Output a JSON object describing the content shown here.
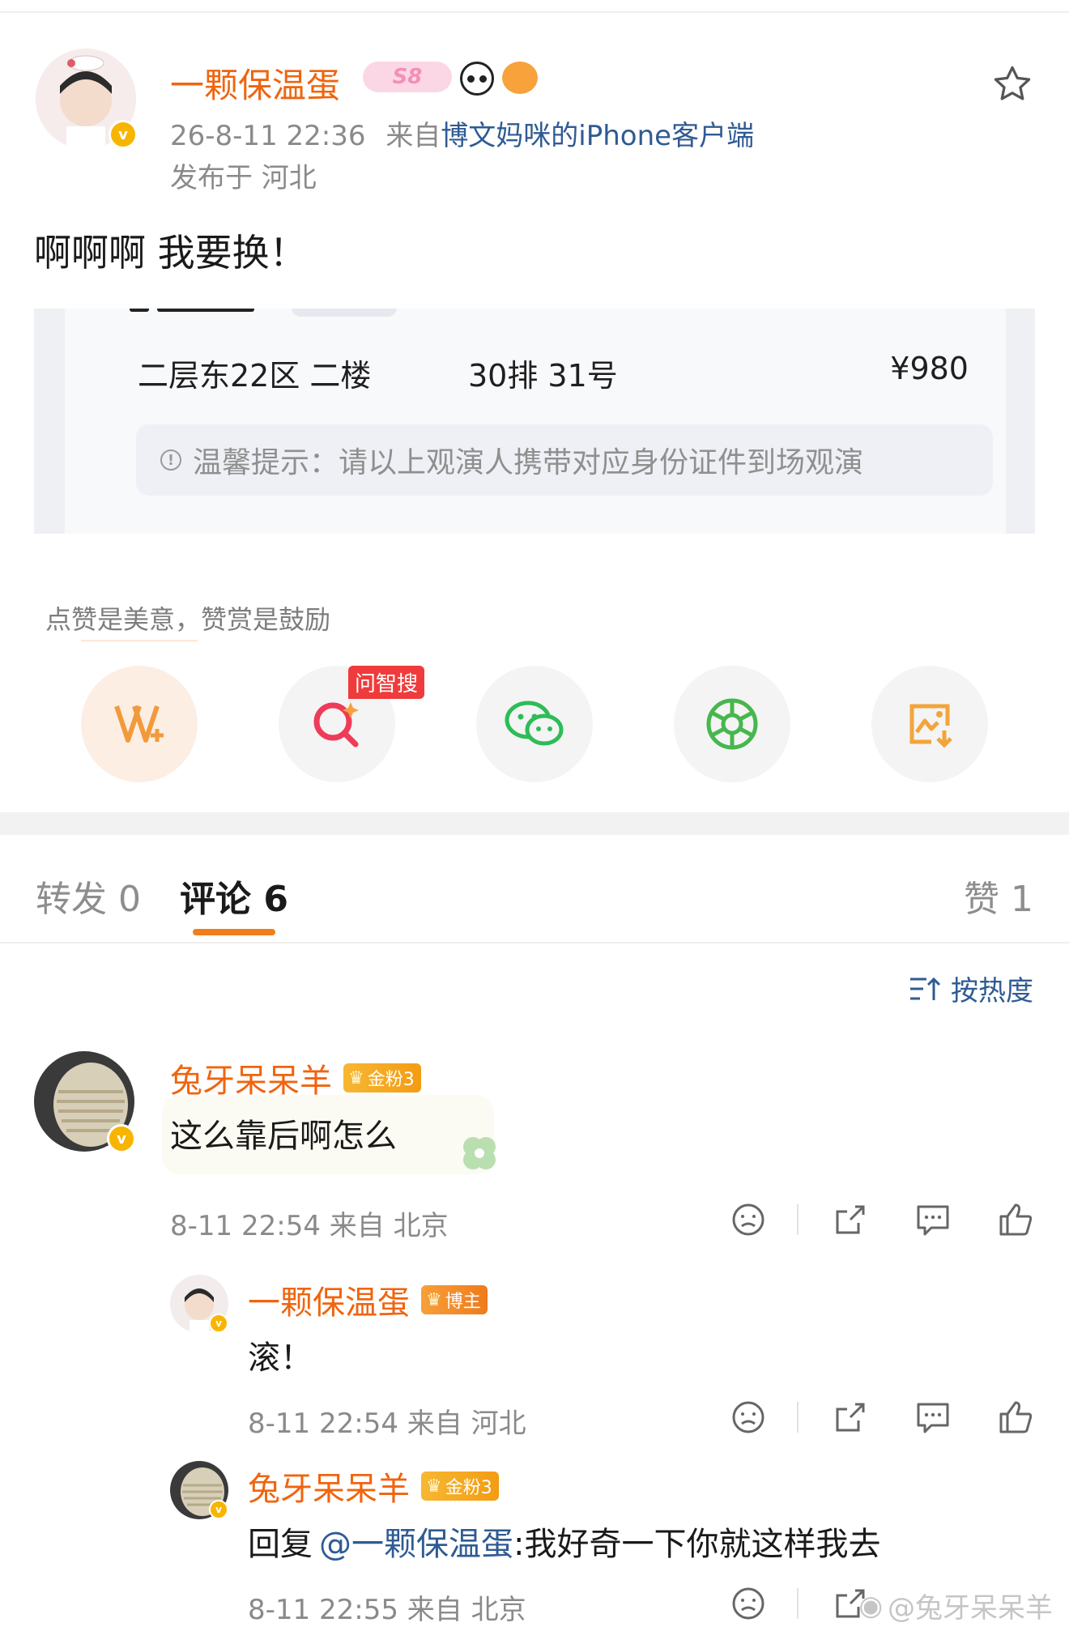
{
  "post": {
    "author": "一颗保温蛋",
    "level_badge": "S8",
    "timestamp": "26-8-11 22:36",
    "source_prefix": "来自",
    "source_device": "博文妈咪的iPhone客户端",
    "location": "发布于 河北",
    "text": "啊啊啊 我要换！"
  },
  "ticket": {
    "seat_area": "二层东22区 二楼",
    "seat_number": "30排 31号",
    "price": "¥980",
    "notice": "温馨提示：请以上观演人携带对应身份证件到场观演"
  },
  "reward_hint": "点赞是美意，赞赏是鼓励",
  "share": {
    "ai_tag": "问智搜",
    "buttons": [
      "vplus-icon",
      "ai-search-icon",
      "wechat-icon",
      "moments-icon",
      "save-image-icon"
    ]
  },
  "tabs": {
    "repost_label": "转发",
    "repost_count": "0",
    "comment_label": "评论",
    "comment_count": "6",
    "like_label": "赞",
    "like_count": "1"
  },
  "sort_label": "按热度",
  "comments": [
    {
      "user": "兔牙呆呆羊",
      "badge": "金粉3",
      "text": "这么靠后啊怎么",
      "time": "8-11 22:54",
      "from": "来自 北京"
    }
  ],
  "replies": [
    {
      "user": "一颗保温蛋",
      "badge": "博主",
      "text": "滚！",
      "time": "8-11 22:54",
      "from": "来自 河北"
    },
    {
      "user": "兔牙呆呆羊",
      "badge": "金粉3",
      "reply_prefix": "回复",
      "reply_to": "@一颗保温蛋",
      "text": ":我好奇一下你就这样我去",
      "time": "8-11 22:55",
      "from": "来自 北京"
    }
  ],
  "watermark": "@兔牙呆呆羊",
  "colors": {
    "accent_orange": "#f0640e",
    "link_blue": "#2f5b93",
    "verified_gold": "#f7b500"
  }
}
